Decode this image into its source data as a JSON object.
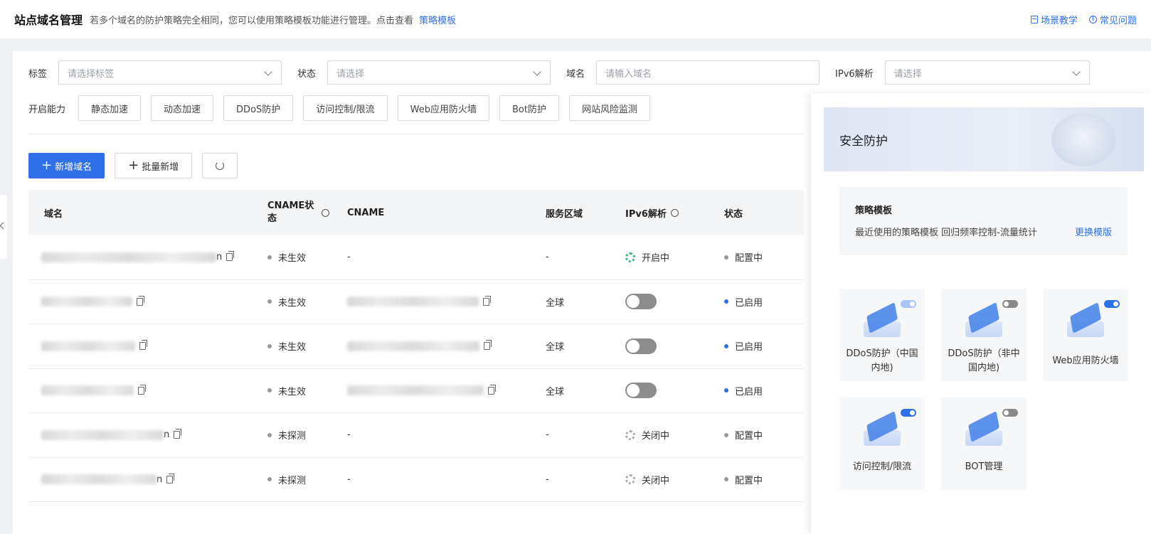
{
  "header": {
    "title": "站点域名管理",
    "desc": "若多个域名的防护策略完全相同，您可以使用策略模板功能进行管理。点击查看",
    "desc_link": "策略模板",
    "links": [
      "场景教学",
      "常见问题"
    ]
  },
  "filters": {
    "tag": {
      "label": "标签",
      "placeholder": "请选择标签"
    },
    "status": {
      "label": "状态",
      "placeholder": "请选择"
    },
    "domain": {
      "label": "域名",
      "placeholder": "请输入域名"
    },
    "ipv6": {
      "label": "IPv6解析",
      "placeholder": "请选择"
    }
  },
  "capabilities": {
    "label": "开启能力",
    "items": [
      "静态加速",
      "动态加速",
      "DDoS防护",
      "访问控制/限流",
      "Web应用防火墙",
      "Bot防护",
      "网站风险监测"
    ]
  },
  "actions": {
    "add": "新增域名",
    "batch_add": "批量新增"
  },
  "table": {
    "headers": {
      "domain": "域名",
      "cname_status": "CNAME状态",
      "cname": "CNAME",
      "region": "服务区域",
      "ipv6": "IPv6解析",
      "status": "状态"
    },
    "rows": [
      {
        "domain_suffix": "n",
        "cname_status": "未生效",
        "cname": "-",
        "region": "-",
        "ipv6": "开启中",
        "status": "配置中"
      },
      {
        "domain_suffix": "",
        "cname_status": "未生效",
        "cname": "",
        "region": "全球",
        "ipv6": "",
        "status": "已启用"
      },
      {
        "domain_suffix": "",
        "cname_status": "未生效",
        "cname": "",
        "region": "全球",
        "ipv6": "",
        "status": "已启用"
      },
      {
        "domain_suffix": "",
        "cname_status": "未生效",
        "cname": "",
        "region": "全球",
        "ipv6": "",
        "status": "已启用"
      },
      {
        "domain_suffix": "n",
        "cname_status": "未探测",
        "cname": "-",
        "region": "-",
        "ipv6": "关闭中",
        "status": "配置中"
      },
      {
        "domain_suffix": "n",
        "cname_status": "未探测",
        "cname": "-",
        "region": "-",
        "ipv6": "关闭中",
        "status": "配置中"
      }
    ]
  },
  "panel": {
    "title": "安全防护",
    "template_title": "策略模板",
    "template_desc": "最近使用的策略模板 回归频率控制-流量统计",
    "template_change": "更换模版",
    "modules": [
      {
        "label": "DDoS防护（中国内地)",
        "state": "light"
      },
      {
        "label": "DDoS防护（非中国内地)",
        "state": "off"
      },
      {
        "label": "Web应用防火墙",
        "state": "on"
      },
      {
        "label": "访问控制/限流",
        "state": "on"
      },
      {
        "label": "BOT管理",
        "state": "off"
      }
    ]
  },
  "colors": {
    "primary": "#2f6fe8",
    "success": "#39b87a",
    "muted": "#9a9a9a"
  }
}
